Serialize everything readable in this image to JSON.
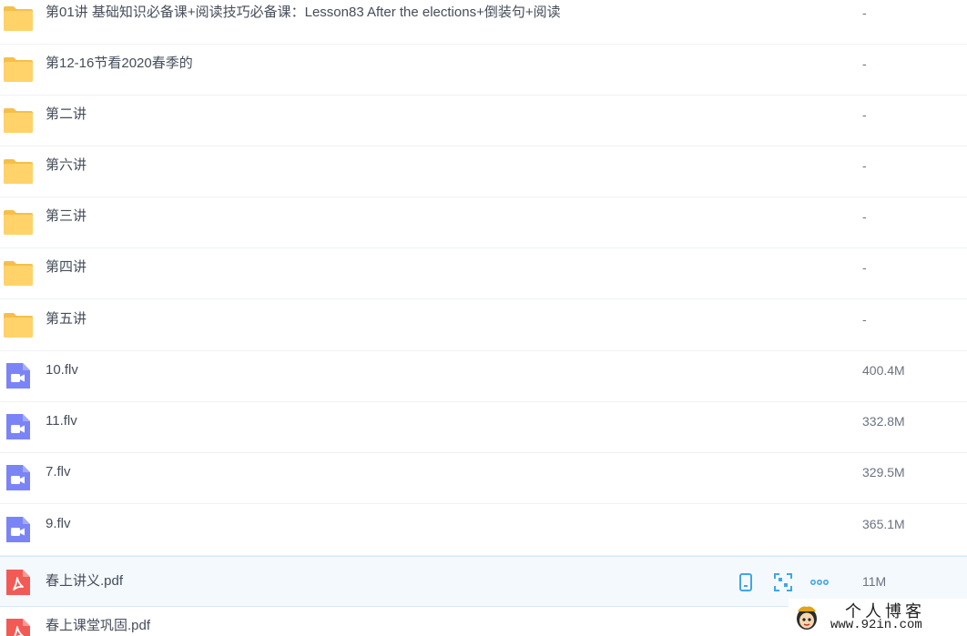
{
  "colors": {
    "folder": "#FFD36A",
    "folder_dark": "#F5BF4A",
    "video": "#7B84F6",
    "pdf": "#F25B55",
    "action_blue": "#3FA6E8",
    "text": "#454D5A",
    "size_text": "#6B7280",
    "hover_bg": "#F4F9FE"
  },
  "files": [
    {
      "name": "第01讲 基础知识必备课+阅读技巧必备课：Lesson83 After the elections+倒装句+阅读",
      "size": "-",
      "type": "folder-icon"
    },
    {
      "name": "第12-16节看2020春季的",
      "size": "-",
      "type": "folder-icon"
    },
    {
      "name": "第二讲",
      "size": "-",
      "type": "folder-icon"
    },
    {
      "name": "第六讲",
      "size": "-",
      "type": "folder-icon"
    },
    {
      "name": "第三讲",
      "size": "-",
      "type": "folder-icon"
    },
    {
      "name": "第四讲",
      "size": "-",
      "type": "folder-icon"
    },
    {
      "name": "第五讲",
      "size": "-",
      "type": "folder-icon"
    },
    {
      "name": "10.flv",
      "size": "400.4M",
      "type": "video-icon"
    },
    {
      "name": "11.flv",
      "size": "332.8M",
      "type": "video-icon"
    },
    {
      "name": "7.flv",
      "size": "329.5M",
      "type": "video-icon"
    },
    {
      "name": "9.flv",
      "size": "365.1M",
      "type": "video-icon"
    },
    {
      "name": "春上讲义.pdf",
      "size": "11M",
      "type": "pdf-icon"
    },
    {
      "name": "春上课堂巩固.pdf",
      "size": "",
      "type": "pdf-icon"
    }
  ],
  "row_actions": [
    {
      "name": "phone-icon"
    },
    {
      "name": "scan-qr-icon"
    },
    {
      "name": "more-icon"
    }
  ],
  "watermark": {
    "title": "个人博客",
    "url": "www.92in.com",
    "avatar": "cartoon-avatar-icon"
  }
}
